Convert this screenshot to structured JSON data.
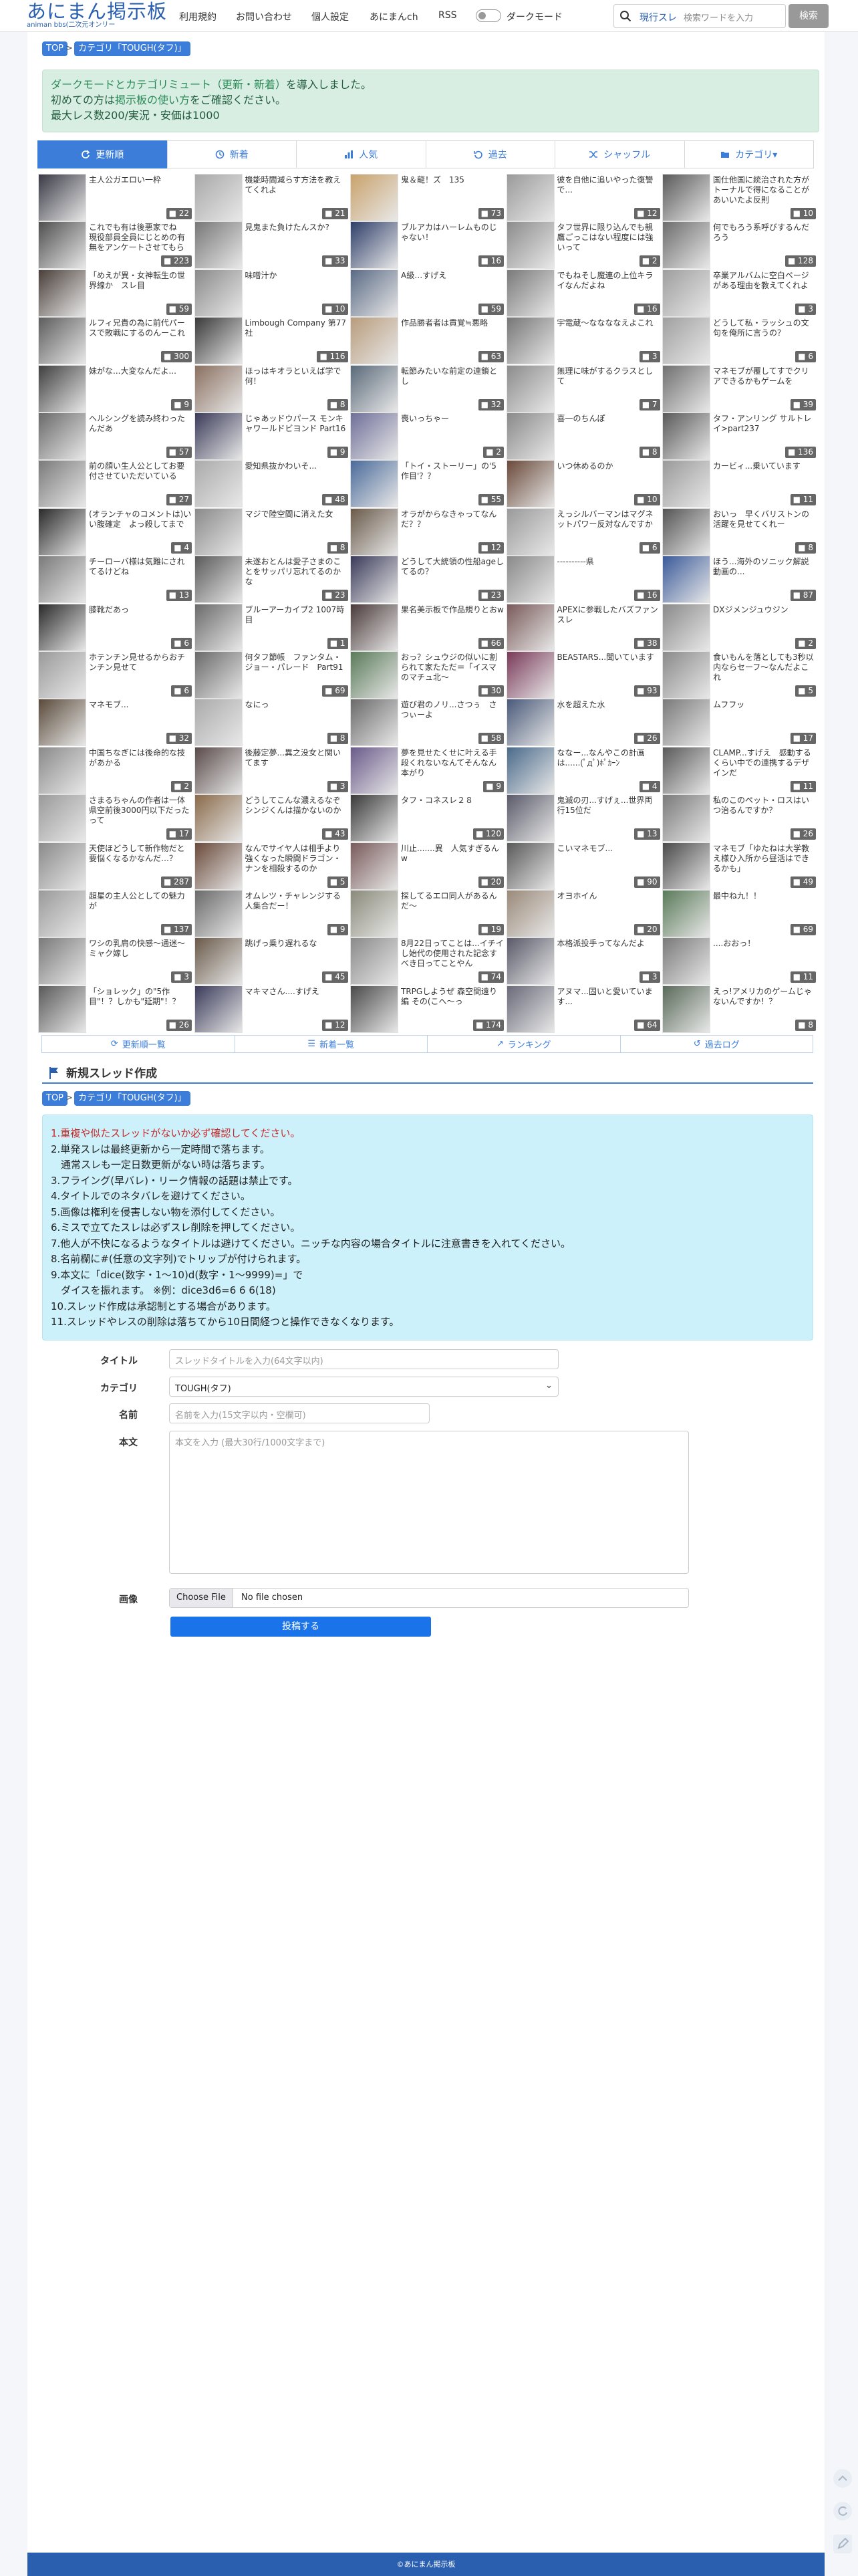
{
  "header": {
    "logo_title": "あにまん掲示板",
    "logo_sub": "animan bbs(二次元オンリー",
    "nav": [
      "利用規約",
      "お問い合わせ",
      "個人設定",
      "あにまんch",
      "RSS"
    ],
    "dark_mode_label": "ダークモード",
    "search_label": "現行スレ",
    "search_placeholder": "検索ワードを入力",
    "search_button": "検索"
  },
  "breadcrumb": {
    "top": "TOP",
    "category": "カテゴリ「TOUGH(タフ)」"
  },
  "notice": {
    "line1_pre": "ダークモードとカテゴリミュート（更新・新着）",
    "line1_post": "を導入しました。",
    "line2_pre": "初めての方は",
    "line2_link": "掲示板の使い方",
    "line2_post": "をご確認ください。",
    "line3": "最大レス数200/実況・安価は1000"
  },
  "tabs": [
    {
      "label": "更新順",
      "icon": "refresh-icon"
    },
    {
      "label": "新着",
      "icon": "clock-icon"
    },
    {
      "label": "人気",
      "icon": "bar-chart-icon"
    },
    {
      "label": "過去",
      "icon": "history-icon"
    },
    {
      "label": "シャッフル",
      "icon": "shuffle-icon"
    },
    {
      "label": "カテゴリ▾",
      "icon": "folder-icon"
    }
  ],
  "threads": [
    {
      "title": "主人公ガエロい一枠",
      "count": "22",
      "color": "#3a3a46"
    },
    {
      "title": "機能時間減らす方法を教えてくれよ",
      "count": "21",
      "color": "#a8a8a8"
    },
    {
      "title": "鬼＆龍！ズ　135",
      "count": "73",
      "color": "#c9a26b"
    },
    {
      "title": "彼を自他に追いやった復讐で...",
      "count": "12",
      "color": "#9b9b9b"
    },
    {
      "title": "国仕他国に統治された方がトーナルで得になることがあいいたよ反則",
      "count": "10",
      "color": "#5a5a5a"
    },
    {
      "title": "これでも有は後悪家でね　現役部員全員にじとめの有無をアンケートさせてもらったよ",
      "count": "223",
      "color": "#4f4f4f"
    },
    {
      "title": "見鬼また負けたんスか?",
      "count": "33",
      "color": "#777"
    },
    {
      "title": "ブルアカはハーレムものじゃない！",
      "count": "16",
      "color": "#2f3f6a"
    },
    {
      "title": "タフ世界に限り込んでも親鷹ごっこはない程度には強いって",
      "count": "2",
      "color": "#8c8c8c"
    },
    {
      "title": "何でもろう系呼びするんだろう",
      "count": "128",
      "color": "#6d6d6d"
    },
    {
      "title": "「めえが異・女神転生の世界線か　スレ目",
      "count": "59",
      "color": "#4a3f3a"
    },
    {
      "title": "味噌汁か",
      "count": "10",
      "color": "#8a8a8a"
    },
    {
      "title": "A級…すげえ",
      "count": "59",
      "color": "#5a6a85"
    },
    {
      "title": "でもねそし魔連の上位キライなんだよね",
      "count": "16",
      "color": "#7a7a7a"
    },
    {
      "title": "卒業アルバムに空白ページがある理由を教えてくれよ",
      "count": "3",
      "color": "#9e9e9e"
    },
    {
      "title": "ルフィ兄貴の為に前代パースで敗戦にするのんーこれ",
      "count": "300",
      "color": "#5d5d5d"
    },
    {
      "title": "Limbough Company 第77社",
      "count": "116",
      "color": "#3a3a3a"
    },
    {
      "title": "作品勝者者は貢覚≒悪略",
      "count": "63",
      "color": "#b89c7c"
    },
    {
      "title": "宇電蔵〜ななななえよこれ",
      "count": "3",
      "color": "#777"
    },
    {
      "title": "どうして私・ラッシュの文句を俺所に言うの？",
      "count": "6",
      "color": "#a0a0a0"
    },
    {
      "title": "妹がな...大変なんだよ...",
      "count": "9",
      "color": "#3f3f3f"
    },
    {
      "title": "ほっはキオラといえば学で何！",
      "count": "8",
      "color": "#8a7060"
    },
    {
      "title": "転節みたいな前定の連鎖とし",
      "count": "32",
      "color": "#5a6a7a"
    },
    {
      "title": "無理に味がするクラスとして",
      "count": "7",
      "color": "#8c8c8c"
    },
    {
      "title": "マネモブが覆してすでクリアできるかもゲームを",
      "count": "39",
      "color": "#707070"
    },
    {
      "title": "ヘルシングを読み終わったんだあ",
      "count": "57",
      "color": "#6a6a6a"
    },
    {
      "title": "じゃあッドウパース モンキャワールドビヨンド Part16",
      "count": "9",
      "color": "#3b3b5a"
    },
    {
      "title": "喪いっちゃー",
      "count": "2",
      "color": "#6f6f9a"
    },
    {
      "title": "喜一のちんぽ",
      "count": "8",
      "color": "#8a8a8a"
    },
    {
      "title": "タフ・アンリング サルトレイ>part237",
      "count": "136",
      "color": "#5a5a5a"
    },
    {
      "title": "前の顔い生人公としてお要付させていただいている",
      "count": "27",
      "color": "#7a7a7a"
    },
    {
      "title": "愛知県抜かわいそ...",
      "count": "48",
      "color": "#aaa"
    },
    {
      "title": "「トイ・ストーリー」の'5作目'？？",
      "count": "55",
      "color": "#4a6a9a"
    },
    {
      "title": "いつ休めるのか",
      "count": "10",
      "color": "#6a4a3a"
    },
    {
      "title": "カービィ...乗いています",
      "count": "11",
      "color": "#9a9a9a"
    },
    {
      "title": "(オランチャのコメントは)いい腹確定　よっ殺してまで",
      "count": "4",
      "color": "#2a2a2a"
    },
    {
      "title": "マジで陸空間に消えた女",
      "count": "8",
      "color": "#8a8a8a"
    },
    {
      "title": "オラがからなきゃってなんだ？？",
      "count": "12",
      "color": "#6a5a4a"
    },
    {
      "title": "えっシルバーマンはマグネットパワー反対なんですか",
      "count": "6",
      "color": "#9a9a9a"
    },
    {
      "title": "おいっ　早くバリストンの活躍を見せてくれー",
      "count": "8",
      "color": "#555"
    },
    {
      "title": "チーローバ様は気難にされてるけどね",
      "count": "13",
      "color": "#7a7a7a"
    },
    {
      "title": "未遂おとんは愛子さまのことをサッパリ忘れてるのかな",
      "count": "23",
      "color": "#5a5a5a"
    },
    {
      "title": "どうして大統領の性船ageしてるの？",
      "count": "23",
      "color": "#3a3a5a"
    },
    {
      "title": "----------県",
      "count": "16",
      "color": "#8a8a8a"
    },
    {
      "title": "ほう...海外のソニック解説動画の...",
      "count": "87",
      "color": "#3a5a9a"
    },
    {
      "title": "膝靴だあっ",
      "count": "6",
      "color": "#2a2a2a"
    },
    {
      "title": "ブルーアーカイブ2 1007時目",
      "count": "1",
      "color": "#6a6a6a"
    },
    {
      "title": "果名美示板で作品規りとおw",
      "count": "66",
      "color": "#4a3a3a"
    },
    {
      "title": "APEXに参戦したバズファンスレ",
      "count": "38",
      "color": "#7a5a5a"
    },
    {
      "title": "DXジメンジュウジン",
      "count": "2",
      "color": "#8a8a8a"
    },
    {
      "title": "ホテンチン見せるからおチンチン見せて",
      "count": "6",
      "color": "#9a9a9a"
    },
    {
      "title": "何タフ節帳　ファンタム・ジョー・パレード　Part91",
      "count": "69",
      "color": "#6a6a6a"
    },
    {
      "title": "おっ？シュウジの似いに割られて家たただ＝「イスマのマチュ北〜",
      "count": "30",
      "color": "#5a7a5a"
    },
    {
      "title": "BEASTARS...聞いています",
      "count": "93",
      "color": "#7a3a5a"
    },
    {
      "title": "食いもんを落としても3秒以内ならセーフ〜なんだよこれ",
      "count": "5",
      "color": "#8a8a8a"
    },
    {
      "title": "マネモブ...",
      "count": "32",
      "color": "#5a4a3a"
    },
    {
      "title": "なにっ",
      "count": "8",
      "color": "#aaa"
    },
    {
      "title": "遊び君のノリ...さつぅ　さつぃーよ",
      "count": "58",
      "color": "#6a6a6a"
    },
    {
      "title": "水を超えた水",
      "count": "26",
      "color": "#4a5a7a"
    },
    {
      "title": "ムフフッ",
      "count": "17",
      "color": "#7a7a7a"
    },
    {
      "title": "中国ちなぎには後命的な技があかる",
      "count": "2",
      "color": "#8a8a8a"
    },
    {
      "title": "後藤定夢...異之没女と関いてます",
      "count": "3",
      "color": "#5a4a4a"
    },
    {
      "title": "夢を見せたくせに叶える手段くれないなんてそんなん本がり",
      "count": "9",
      "color": "#6a5a8a"
    },
    {
      "title": "ななー...なんやこの計画は......(ﾟдﾟ)ﾎﾟｶｰﾝ",
      "count": "4",
      "color": "#4a6a8a"
    },
    {
      "title": "CLAMP...すげえ　感動するくらい中での連携するデザインだ",
      "count": "11",
      "color": "#5a5a5a"
    },
    {
      "title": "さまるちゃんの作者は一体県空前後3000円以下だったって",
      "count": "17",
      "color": "#9a9a9a"
    },
    {
      "title": "どうしてこんな濃えるなぞシンジくんは描かないのか",
      "count": "43",
      "color": "#8a6a4a"
    },
    {
      "title": "タフ・コネスレ２８",
      "count": "120",
      "color": "#3a3a3a"
    },
    {
      "title": "鬼滅の刃...すげぇ...世界両行15位だ",
      "count": "13",
      "color": "#5a5a6a"
    },
    {
      "title": "私のこのペット・ロスはいつ治るんですか？",
      "count": "26",
      "color": "#7a7a7a"
    },
    {
      "title": "天使ほどうして新作物だと要悩くなるかなんだ…？",
      "count": "287",
      "color": "#8a8a8a"
    },
    {
      "title": "なんでサイヤ人は相手より強くなった瞬間ドラゴン・ナンを相殺するのか",
      "count": "5",
      "color": "#6a4a3a"
    },
    {
      "title": "川止.......異　人気すぎるんw",
      "count": "20",
      "color": "#7a5a5a"
    },
    {
      "title": "こいマネモブ...",
      "count": "90",
      "color": "#5a5a5a"
    },
    {
      "title": "マネモブ「ゆたねは大学教え様ひ入所から昼活はできるかも」",
      "count": "49",
      "color": "#4a4a4a"
    },
    {
      "title": "超星の主人公としての魅力が",
      "count": "137",
      "color": "#9a9a9a"
    },
    {
      "title": "オムレツ・チャレンジする人集合だー！",
      "count": "9",
      "color": "#6a6a6a"
    },
    {
      "title": "探してるエロ同人があるんだ〜",
      "count": "19",
      "color": "#8a8a7a"
    },
    {
      "title": "オヨホイん",
      "count": "20",
      "color": "#9a8a7a"
    },
    {
      "title": "最中ね九！！",
      "count": "69",
      "color": "#5a7a5a"
    },
    {
      "title": "ワシの乳肩の快感〜通迷〜ミャク嫁し",
      "count": "3",
      "color": "#7a7a7a"
    },
    {
      "title": "跳げっ乗り遅れるな",
      "count": "45",
      "color": "#6a5a4a"
    },
    {
      "title": "8月22日ってことは...イチイし始代の使用された記念すべき日ってことやん",
      "count": "74",
      "color": "#8a8a8a"
    },
    {
      "title": "本格派投手ってなんだよ",
      "count": "3",
      "color": "#5a5a6a"
    },
    {
      "title": "....おおっ！",
      "count": "11",
      "color": "#7a7a7a"
    },
    {
      "title": "「ショレック」の\"5作目\"！？しかも\"延期\"！？",
      "count": "26",
      "color": "#5a5a5a"
    },
    {
      "title": "マキマさん....すげえ",
      "count": "12",
      "color": "#3a3a5a"
    },
    {
      "title": "TRPGしようぜ 森空間遠り編 その(こへ〜っ",
      "count": "174",
      "color": "#4a4a4a"
    },
    {
      "title": "アヌマ...固いと愛いています...",
      "count": "64",
      "color": "#6a6a7a"
    },
    {
      "title": "えっ!アメリカのゲームじゃないんですか！？",
      "count": "8",
      "color": "#5a6a5a"
    }
  ],
  "subnav": [
    {
      "label": "更新順一覧",
      "icon": "refresh-icon"
    },
    {
      "label": "新着一覧",
      "icon": "list-icon"
    },
    {
      "label": "ランキング",
      "icon": "chart-icon"
    },
    {
      "label": "過去ログ",
      "icon": "history-icon"
    }
  ],
  "new_thread": {
    "heading": "新規スレッド作成",
    "rules": [
      {
        "text": "1.重複や似たスレッドがないか必ず確認してください。",
        "style": "r"
      },
      {
        "text": "2.単発スレは最終更新から一定時間で落ちます。",
        "style": ""
      },
      {
        "text": "　通常スレも一定日数更新がない時は落ちます。",
        "style": ""
      },
      {
        "text": "3.フライング(早バレ)・リーク情報の話題は禁止です。",
        "style": ""
      },
      {
        "text": "4.タイトルでのネタバレを避けてください。",
        "style": ""
      },
      {
        "text": "5.画像は権利を侵害しない物を添付してください。",
        "style": ""
      },
      {
        "text": "6.ミスで立てたスレは必ずスレ削除を押してください。",
        "style": ""
      },
      {
        "text": "7.他人が不快になるようなタイトルは避けてください。ニッチな内容の場合タイトルに注意書きを入れてください。",
        "style": ""
      },
      {
        "text": "8.名前欄に#(任意の文字列)でトリップが付けられます。",
        "style": ""
      },
      {
        "text": "9.本文に「dice(数字・1〜10)d(数字・1〜9999)=」で",
        "style": ""
      },
      {
        "text": "　ダイスを振れます。 ※例：dice3d6=6 6 6(18)",
        "style": ""
      },
      {
        "text": "10.スレッド作成は承認制とする場合があります。",
        "style": ""
      },
      {
        "text": "11.スレッドやレスの削除は落ちてから10日間経つと操作できなくなります。",
        "style": ""
      }
    ],
    "title_label": "タイトル",
    "title_placeholder": "スレッドタイトルを入力(64文字以内)",
    "category_label": "カテゴリ",
    "category_value": "TOUGH(タフ)",
    "name_label": "名前",
    "name_placeholder": "名前を入力(15文字以内・空欄可)",
    "body_label": "本文",
    "body_placeholder": "本文を入力 (最大30行/1000文字まで)",
    "image_label": "画像",
    "file_button": "Choose File",
    "file_status": "No file chosen",
    "submit": "投稿する"
  },
  "footer": "©あにまん掲示板"
}
